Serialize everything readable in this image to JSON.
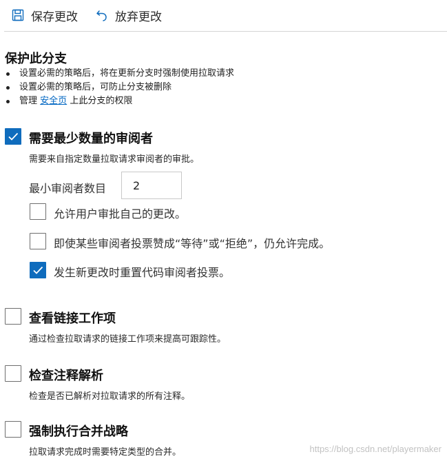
{
  "toolbar": {
    "save_label": "保存更改",
    "discard_label": "放弃更改"
  },
  "section": {
    "title": "保护此分支",
    "bullets": [
      "设置必需的策略后，将在更新分支时强制使用拉取请求",
      "设置必需的策略后，可防止分支被删除"
    ],
    "bullet3": {
      "prefix": "管理",
      "link": "安全页",
      "suffix": "上此分支的权限"
    }
  },
  "policies": {
    "min_reviewers": {
      "checked": true,
      "title": "需要最少数量的审阅者",
      "desc": "需要来自指定数量拉取请求审阅者的审批。",
      "count_label": "最小审阅者数目",
      "count_value": "2",
      "options": [
        {
          "label": "允许用户审批自己的更改。",
          "checked": false
        },
        {
          "label": "即使某些审阅者投票赞成“等待”或“拒绝”，仍允许完成。",
          "checked": false
        },
        {
          "label": "发生新更改时重置代码审阅者投票。",
          "checked": true
        }
      ]
    },
    "linked_work_items": {
      "checked": false,
      "title": "查看链接工作项",
      "desc": "通过检查拉取请求的链接工作项来提高可跟踪性。"
    },
    "comment_resolution": {
      "checked": false,
      "title": "检查注释解析",
      "desc": "检查是否已解析对拉取请求的所有注释。"
    },
    "merge_strategy": {
      "checked": false,
      "title": "强制执行合并战略",
      "desc": "拉取请求完成时需要特定类型的合并。"
    }
  },
  "watermark": "https://blog.csdn.net/playermaker"
}
